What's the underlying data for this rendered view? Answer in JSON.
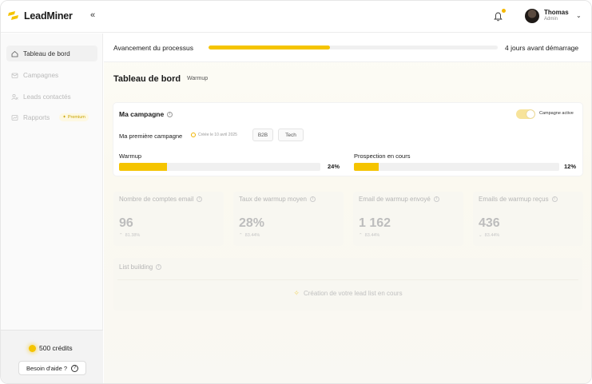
{
  "app": {
    "name": "LeadMiner"
  },
  "header": {
    "collapse_icon": "«",
    "user": {
      "name": "Thomas",
      "role": "Admin"
    }
  },
  "sidebar": {
    "items": [
      {
        "label": "Tableau de bord",
        "icon": "home-icon",
        "active": true
      },
      {
        "label": "Campagnes",
        "icon": "mail-icon",
        "active": false
      },
      {
        "label": "Leads contactés",
        "icon": "users-icon",
        "active": false
      },
      {
        "label": "Rapports",
        "icon": "report-icon",
        "active": false,
        "badge": "Premium"
      }
    ],
    "credits": "500 crédits",
    "help_label": "Besoin d'aide ?",
    "help_icon": "?"
  },
  "process": {
    "label": "Avancement du processus",
    "progress": 0.42,
    "right_text": "4 jours avant démarrage"
  },
  "page": {
    "title": "Tableau de bord",
    "subtitle": "Warmup"
  },
  "campaign": {
    "title": "Ma campagne",
    "toggle_label": "Campagne active",
    "toggle_on": true,
    "name": "Ma première campagne",
    "created": "Créée le 10 avril 2025",
    "tags": [
      "B2B",
      "Tech"
    ],
    "warmup": {
      "label": "Warmup",
      "percent": 24,
      "percent_text": "24%"
    },
    "prospection": {
      "label": "Prospection en cours",
      "percent": 12,
      "percent_text": "12%"
    }
  },
  "stats": [
    {
      "label": "Nombre de  comptes email",
      "value": "96",
      "delta": "81.38%",
      "direction": "up"
    },
    {
      "label": "Taux de warmup moyen",
      "value": "28%",
      "delta": "83.44%",
      "direction": "up"
    },
    {
      "label": "Email de warmup envoyé",
      "value": "1 162",
      "delta": "83.44%",
      "direction": "up"
    },
    {
      "label": "Emails de warmup reçus",
      "value": "436",
      "delta": "83.44%",
      "direction": "down"
    }
  ],
  "list_building": {
    "title": "List building",
    "status": "Création de votre lead list en cours"
  },
  "colors": {
    "accent": "#f5c400",
    "text": "#1a1a1a",
    "muted": "#b5b5b5"
  }
}
